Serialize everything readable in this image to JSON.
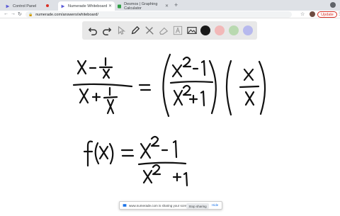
{
  "browser": {
    "tabs": [
      {
        "title": "Control Panel"
      },
      {
        "title": "Numerade Whiteboard"
      },
      {
        "title": "Desmos | Graphing Calculator"
      }
    ],
    "url": "numerade.com/answers/whiteboard/",
    "update_label": "Update"
  },
  "whiteboard": {
    "colors": [
      "#1a1a1a",
      "#f2b8b8",
      "#b9d9b0",
      "#b7b9ee"
    ]
  },
  "share": {
    "message": "www.numerade.com is sharing your screen.",
    "stop_label": "Stop sharing",
    "hide_label": "Hide"
  }
}
